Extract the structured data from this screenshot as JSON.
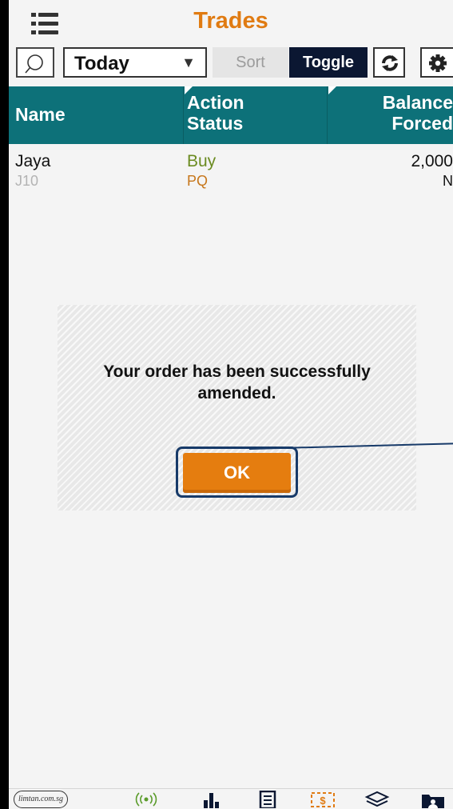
{
  "header": {
    "title": "Trades"
  },
  "toolbar": {
    "date_filter": "Today",
    "sort_label": "Sort",
    "toggle_label": "Toggle"
  },
  "table": {
    "columns": {
      "name": "Name",
      "action": "Action",
      "status": "Status",
      "balance": "Balance",
      "forced": "Forced"
    },
    "rows": [
      {
        "name": "Jaya",
        "code": "J10",
        "action": "Buy",
        "status": "PQ",
        "balance": "2,000",
        "forced": "N"
      }
    ]
  },
  "dialog": {
    "message": "Your order has been successfully amended.",
    "ok_label": "OK"
  },
  "tabbar": {
    "logo_text": "limtan.com.sg"
  },
  "colors": {
    "title": "#e07b12",
    "table_header": "#0d7179",
    "toggle_bg": "#0b1732",
    "ok_button": "#e57d0f",
    "action_buy": "#6b8b21",
    "status_pq": "#c7771b"
  },
  "icons": {
    "menu": "menu-icon",
    "search": "search-icon",
    "refresh": "refresh-icon",
    "settings": "gear-icon"
  }
}
